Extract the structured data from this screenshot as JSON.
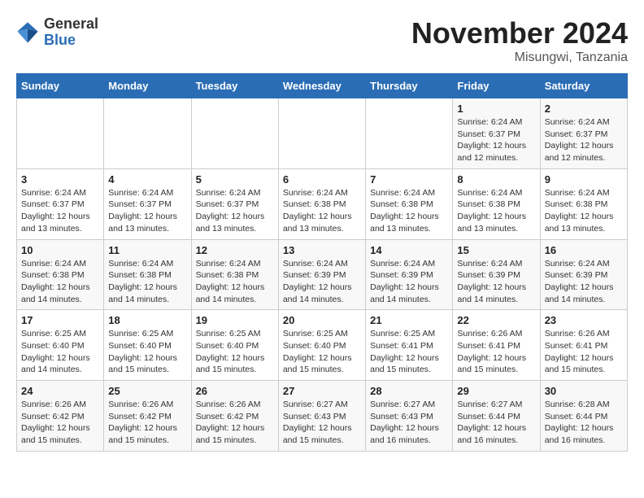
{
  "logo": {
    "general": "General",
    "blue": "Blue"
  },
  "header": {
    "month": "November 2024",
    "location": "Misungwi, Tanzania"
  },
  "days_of_week": [
    "Sunday",
    "Monday",
    "Tuesday",
    "Wednesday",
    "Thursday",
    "Friday",
    "Saturday"
  ],
  "weeks": [
    [
      {
        "day": "",
        "info": ""
      },
      {
        "day": "",
        "info": ""
      },
      {
        "day": "",
        "info": ""
      },
      {
        "day": "",
        "info": ""
      },
      {
        "day": "",
        "info": ""
      },
      {
        "day": "1",
        "info": "Sunrise: 6:24 AM\nSunset: 6:37 PM\nDaylight: 12 hours and 12 minutes."
      },
      {
        "day": "2",
        "info": "Sunrise: 6:24 AM\nSunset: 6:37 PM\nDaylight: 12 hours and 12 minutes."
      }
    ],
    [
      {
        "day": "3",
        "info": "Sunrise: 6:24 AM\nSunset: 6:37 PM\nDaylight: 12 hours and 13 minutes."
      },
      {
        "day": "4",
        "info": "Sunrise: 6:24 AM\nSunset: 6:37 PM\nDaylight: 12 hours and 13 minutes."
      },
      {
        "day": "5",
        "info": "Sunrise: 6:24 AM\nSunset: 6:37 PM\nDaylight: 12 hours and 13 minutes."
      },
      {
        "day": "6",
        "info": "Sunrise: 6:24 AM\nSunset: 6:38 PM\nDaylight: 12 hours and 13 minutes."
      },
      {
        "day": "7",
        "info": "Sunrise: 6:24 AM\nSunset: 6:38 PM\nDaylight: 12 hours and 13 minutes."
      },
      {
        "day": "8",
        "info": "Sunrise: 6:24 AM\nSunset: 6:38 PM\nDaylight: 12 hours and 13 minutes."
      },
      {
        "day": "9",
        "info": "Sunrise: 6:24 AM\nSunset: 6:38 PM\nDaylight: 12 hours and 13 minutes."
      }
    ],
    [
      {
        "day": "10",
        "info": "Sunrise: 6:24 AM\nSunset: 6:38 PM\nDaylight: 12 hours and 14 minutes."
      },
      {
        "day": "11",
        "info": "Sunrise: 6:24 AM\nSunset: 6:38 PM\nDaylight: 12 hours and 14 minutes."
      },
      {
        "day": "12",
        "info": "Sunrise: 6:24 AM\nSunset: 6:38 PM\nDaylight: 12 hours and 14 minutes."
      },
      {
        "day": "13",
        "info": "Sunrise: 6:24 AM\nSunset: 6:39 PM\nDaylight: 12 hours and 14 minutes."
      },
      {
        "day": "14",
        "info": "Sunrise: 6:24 AM\nSunset: 6:39 PM\nDaylight: 12 hours and 14 minutes."
      },
      {
        "day": "15",
        "info": "Sunrise: 6:24 AM\nSunset: 6:39 PM\nDaylight: 12 hours and 14 minutes."
      },
      {
        "day": "16",
        "info": "Sunrise: 6:24 AM\nSunset: 6:39 PM\nDaylight: 12 hours and 14 minutes."
      }
    ],
    [
      {
        "day": "17",
        "info": "Sunrise: 6:25 AM\nSunset: 6:40 PM\nDaylight: 12 hours and 14 minutes."
      },
      {
        "day": "18",
        "info": "Sunrise: 6:25 AM\nSunset: 6:40 PM\nDaylight: 12 hours and 15 minutes."
      },
      {
        "day": "19",
        "info": "Sunrise: 6:25 AM\nSunset: 6:40 PM\nDaylight: 12 hours and 15 minutes."
      },
      {
        "day": "20",
        "info": "Sunrise: 6:25 AM\nSunset: 6:40 PM\nDaylight: 12 hours and 15 minutes."
      },
      {
        "day": "21",
        "info": "Sunrise: 6:25 AM\nSunset: 6:41 PM\nDaylight: 12 hours and 15 minutes."
      },
      {
        "day": "22",
        "info": "Sunrise: 6:26 AM\nSunset: 6:41 PM\nDaylight: 12 hours and 15 minutes."
      },
      {
        "day": "23",
        "info": "Sunrise: 6:26 AM\nSunset: 6:41 PM\nDaylight: 12 hours and 15 minutes."
      }
    ],
    [
      {
        "day": "24",
        "info": "Sunrise: 6:26 AM\nSunset: 6:42 PM\nDaylight: 12 hours and 15 minutes."
      },
      {
        "day": "25",
        "info": "Sunrise: 6:26 AM\nSunset: 6:42 PM\nDaylight: 12 hours and 15 minutes."
      },
      {
        "day": "26",
        "info": "Sunrise: 6:26 AM\nSunset: 6:42 PM\nDaylight: 12 hours and 15 minutes."
      },
      {
        "day": "27",
        "info": "Sunrise: 6:27 AM\nSunset: 6:43 PM\nDaylight: 12 hours and 15 minutes."
      },
      {
        "day": "28",
        "info": "Sunrise: 6:27 AM\nSunset: 6:43 PM\nDaylight: 12 hours and 16 minutes."
      },
      {
        "day": "29",
        "info": "Sunrise: 6:27 AM\nSunset: 6:44 PM\nDaylight: 12 hours and 16 minutes."
      },
      {
        "day": "30",
        "info": "Sunrise: 6:28 AM\nSunset: 6:44 PM\nDaylight: 12 hours and 16 minutes."
      }
    ]
  ]
}
